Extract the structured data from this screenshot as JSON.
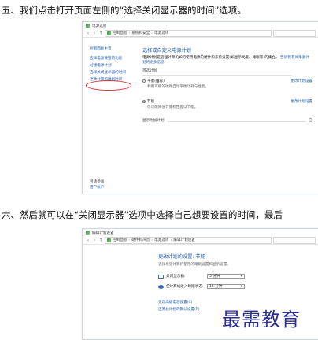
{
  "steps": {
    "five": "五、我们点击打开页面左侧的“选择关闭显示器的时间”选项。",
    "six": "六、然后就可以在“关闭显示器”选项中选择自己想要设置的时间，最后"
  },
  "shot1": {
    "window_title": "电源选项",
    "breadcrumbs": [
      "控制面板",
      "系统和安全",
      "电源选项"
    ],
    "sidebar_top": [
      "控制面板主页",
      "选择电源按钮的功能",
      "创建电源计划",
      "选择关闭显示器的时间",
      "更改计算机睡眠时间"
    ],
    "sidebar_bottom": [
      "另请参阅",
      "用户帐户"
    ],
    "heading": "选择或自定义电源计划",
    "description": "电源计划是管理计算机如何使用电源的硬件和系统设置(如显示亮度、睡眠等)的集合。",
    "description_link": "告诉我有关电源计划的更多信息",
    "section_label": "首选计划",
    "plans": [
      {
        "name": "平衡(推荐)",
        "desc": "利用可用的硬件自动平衡功耗与性能。",
        "change": "更改计划设置",
        "selected": false
      },
      {
        "name": "节能",
        "desc": "尽可能降低计算机性能以节能。",
        "change": "更改计划设置",
        "selected": true
      }
    ],
    "extra_label": "显示附加计划"
  },
  "shot2": {
    "window_title": "编辑计划设置",
    "breadcrumbs": [
      "控制面板",
      "硬件和声音",
      "电源选项",
      "编辑计划设置"
    ],
    "heading": "更改计划的设置: 节能",
    "description": "选择希望计算机使用的睡眠设置和显示设置。",
    "settings": [
      {
        "label": "关闭显示器:",
        "value": "5 分钟"
      },
      {
        "label": "使计算机进入睡眠状态:",
        "value": "15 分钟"
      }
    ],
    "links": [
      "更改高级电源设置(C)",
      "还原此计划的默认设置(R)"
    ]
  },
  "watermark": "最需教育",
  "colors": {
    "link": "#1f5fb5",
    "highlight_oval": "#e03030",
    "watermark": "#2a2f8f"
  }
}
